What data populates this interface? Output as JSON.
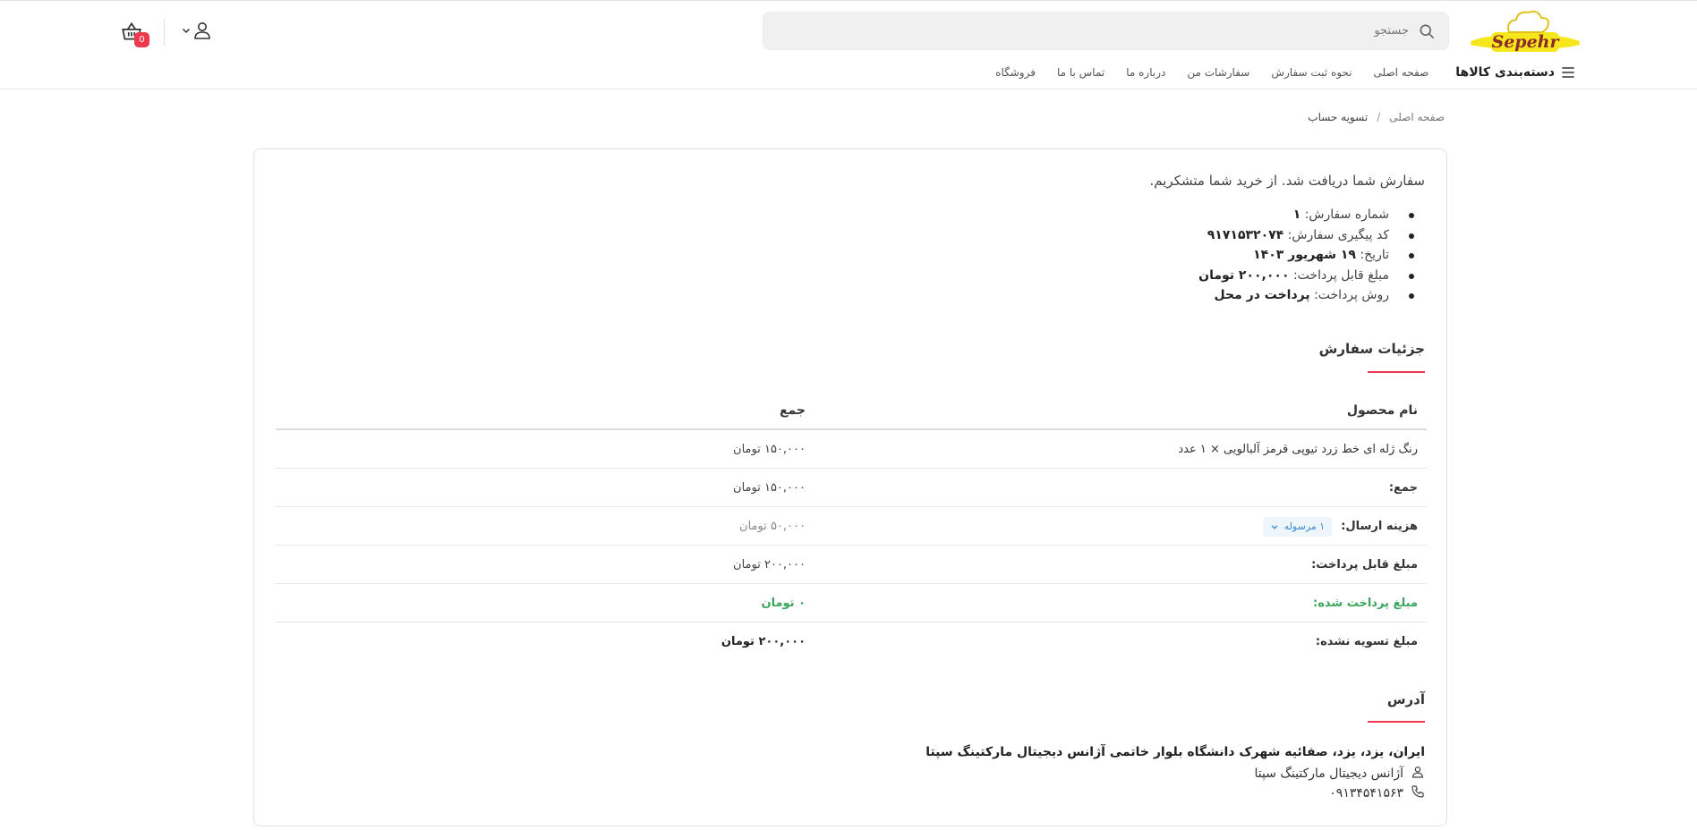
{
  "header": {
    "logo_text": "Sepehr",
    "search_placeholder": "جستجو",
    "cart_count": "0"
  },
  "nav": {
    "categories_label": "دسته‌بندی کالاها",
    "links": [
      "صفحه اصلی",
      "نحوه ثبت سفارش",
      "سفارشات من",
      "درباره ما",
      "تماس با ما",
      "فروشگاه"
    ]
  },
  "breadcrumb": {
    "home": "صفحه اصلی",
    "separator": "/",
    "current": "تسویه حساب"
  },
  "order": {
    "thanks_message": "سفارش شما دریافت شد. از خرید شما متشکریم.",
    "summary": [
      {
        "label": "شماره سفارش:",
        "value": "۱"
      },
      {
        "label": "کد پیگیری سفارش:",
        "value": "۹۱۷۱۵۳۲۰۷۴"
      },
      {
        "label": "تاریخ:",
        "value": "۱۹ شهریور ۱۴۰۳"
      },
      {
        "label": "مبلغ قابل پرداخت:",
        "value": "۲۰۰,۰۰۰ تومان"
      },
      {
        "label": "روش پرداخت:",
        "value": "پرداخت در محل"
      }
    ]
  },
  "details": {
    "title": "جزئیات سفارش",
    "col_product": "نام محصول",
    "col_total": "جمع",
    "product_name": "رنگ ژله ای خط زرد تیوپی قرمز آلبالویی × ۱ عدد",
    "product_total": "۱۵۰,۰۰۰ تومان",
    "subtotal_label": "جمع:",
    "subtotal_value": "۱۵۰,۰۰۰ تومان",
    "shipping_label": "هزینه ارسال:",
    "shipping_pill": "۱ مرسوله",
    "shipping_value": "۵۰,۰۰۰ تومان",
    "payable_label": "مبلغ قابل پرداخت:",
    "payable_value": "۲۰۰,۰۰۰ تومان",
    "paid_label": "مبلغ پرداخت شده:",
    "paid_value": "۰ تومان",
    "unsettled_label": "مبلغ تسویه نشده:",
    "unsettled_value": "۲۰۰,۰۰۰ تومان"
  },
  "address": {
    "title": "آدرس",
    "full": "ایران، یزد، یزد، صفائیه شهرک دانشگاه بلوار خاتمی آژانس دیجیتال مارکتینگ سپتا",
    "name": "آژانس دیجیتال مارکتینگ سپتا",
    "phone": "۰۹۱۳۴۵۴۱۵۶۳"
  },
  "colors": {
    "accent_red": "#ef394e",
    "paid_green": "#3ca55c",
    "logo_yellow": "#f5e71b",
    "logo_text": "#8a2a2a"
  }
}
